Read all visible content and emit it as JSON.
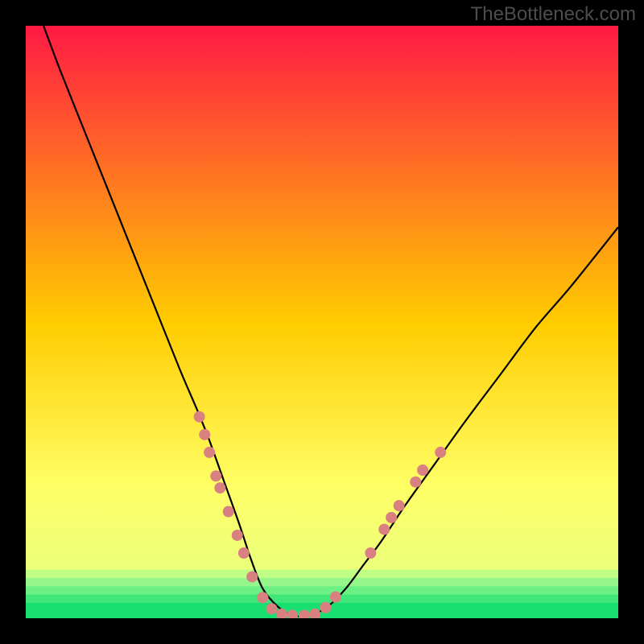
{
  "watermark": "TheBottleneck.com",
  "chart_data": {
    "type": "line",
    "title": "",
    "xlabel": "",
    "ylabel": "",
    "xlim": [
      0,
      100
    ],
    "ylim": [
      0,
      100
    ],
    "grid": false,
    "legend": false,
    "background": {
      "kind": "vertical-gradient",
      "stops": [
        {
          "pos": 0.0,
          "color": "#ff1a44"
        },
        {
          "pos": 0.5,
          "color": "#ffcc00"
        },
        {
          "pos": 0.78,
          "color": "#ffff66"
        },
        {
          "pos": 0.92,
          "color": "#eaff7a"
        },
        {
          "pos": 1.0,
          "color": "#19e06f"
        }
      ],
      "bottom_bands": [
        {
          "color": "#bfff86",
          "from": 0.918,
          "to": 0.932
        },
        {
          "color": "#95f78a",
          "from": 0.932,
          "to": 0.946
        },
        {
          "color": "#6cf084",
          "from": 0.946,
          "to": 0.96
        },
        {
          "color": "#40e67a",
          "from": 0.96,
          "to": 0.974
        },
        {
          "color": "#19df70",
          "from": 0.974,
          "to": 1.0
        }
      ]
    },
    "series": [
      {
        "name": "bottleneck-curve",
        "color": "#000000",
        "x": [
          3,
          6,
          10,
          14,
          18,
          22,
          26,
          29,
          31,
          33.5,
          36,
          38,
          40,
          42.5,
          45,
          48,
          51,
          54,
          57,
          60,
          64,
          69,
          74,
          80,
          86,
          92,
          100
        ],
        "y": [
          100,
          92,
          82,
          72,
          62,
          52,
          42,
          35,
          30,
          23,
          16,
          10,
          5,
          2,
          0.5,
          0.5,
          2,
          5,
          9,
          13,
          19,
          26,
          33,
          41,
          49,
          56,
          66
        ]
      }
    ],
    "markers": {
      "name": "sample-dots",
      "color": "#d98080",
      "radius_px": 7,
      "points": [
        {
          "x": 29.3,
          "y": 34
        },
        {
          "x": 30.2,
          "y": 31
        },
        {
          "x": 31.0,
          "y": 28
        },
        {
          "x": 32.1,
          "y": 24
        },
        {
          "x": 32.8,
          "y": 22
        },
        {
          "x": 34.2,
          "y": 18
        },
        {
          "x": 35.7,
          "y": 14
        },
        {
          "x": 36.8,
          "y": 11
        },
        {
          "x": 38.2,
          "y": 7
        },
        {
          "x": 40.0,
          "y": 3.5
        },
        {
          "x": 41.5,
          "y": 1.6
        },
        {
          "x": 43.2,
          "y": 0.7
        },
        {
          "x": 45.0,
          "y": 0.5
        },
        {
          "x": 47.0,
          "y": 0.5
        },
        {
          "x": 48.8,
          "y": 0.7
        },
        {
          "x": 50.6,
          "y": 1.8
        },
        {
          "x": 52.3,
          "y": 3.6
        },
        {
          "x": 58.2,
          "y": 11
        },
        {
          "x": 60.5,
          "y": 15
        },
        {
          "x": 61.7,
          "y": 17
        },
        {
          "x": 63.0,
          "y": 19
        },
        {
          "x": 65.8,
          "y": 23
        },
        {
          "x": 67.0,
          "y": 25
        },
        {
          "x": 70.0,
          "y": 28
        }
      ]
    }
  }
}
